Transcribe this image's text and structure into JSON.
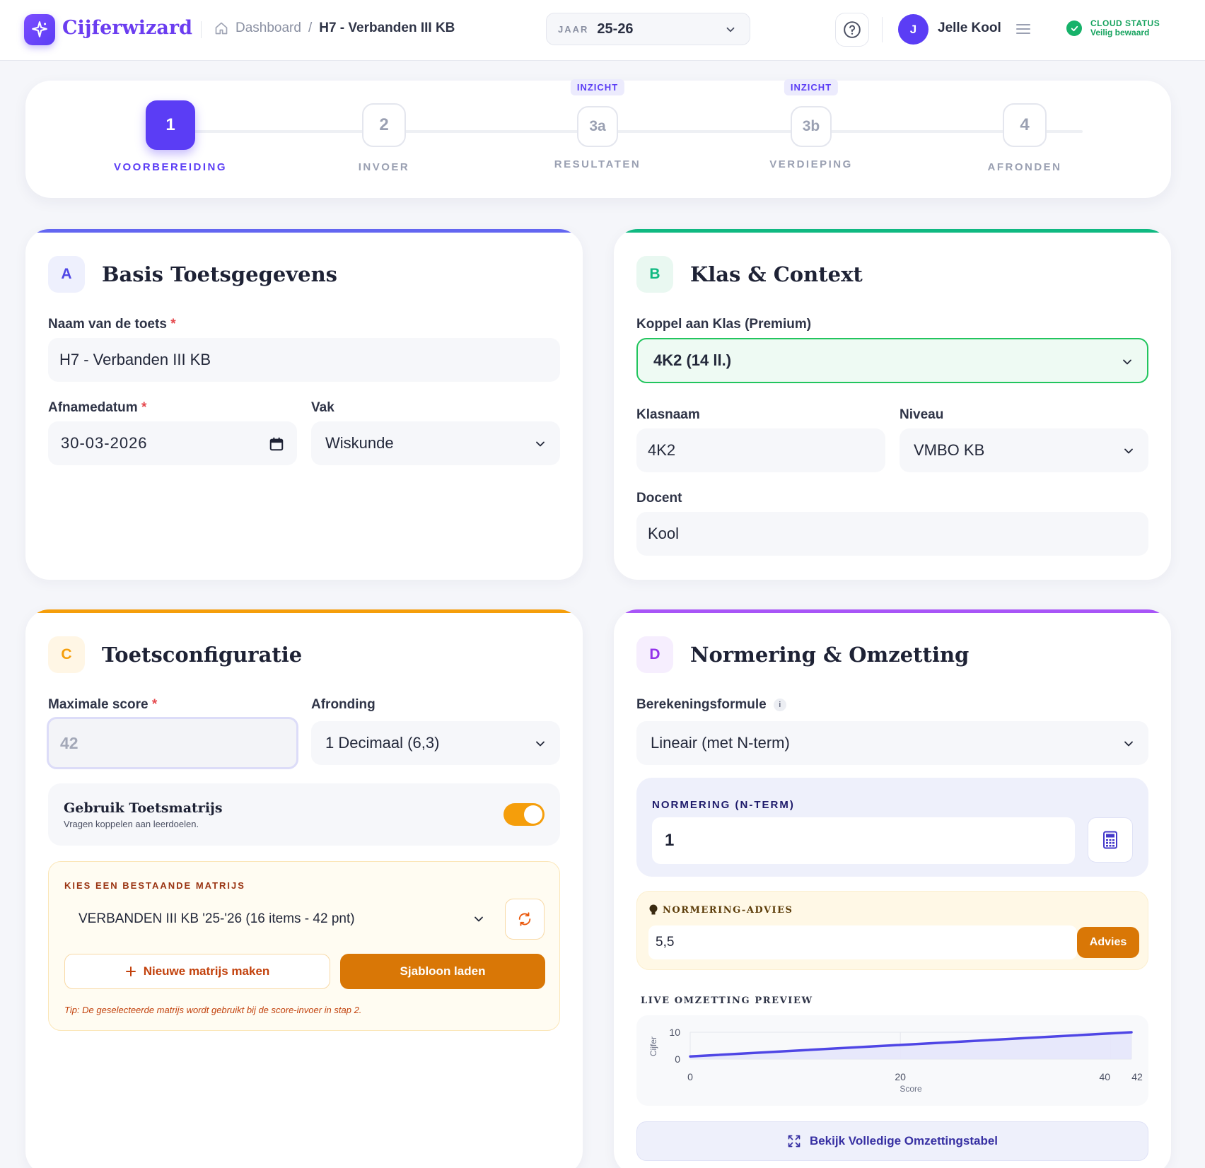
{
  "header": {
    "app_name": "Cijferwizard",
    "breadcrumb": {
      "home": "Dashboard",
      "separator": "/",
      "current": "H7 - Verbanden III KB"
    },
    "year": {
      "label": "JAAR",
      "value": "25-26"
    },
    "user": {
      "initial": "J",
      "name": "Jelle Kool"
    },
    "cloud": {
      "title": "CLOUD STATUS",
      "status": "Veilig bewaard"
    }
  },
  "stepper": {
    "steps": [
      {
        "number": "1",
        "label": "VOORBEREIDING",
        "badge": "",
        "active": true
      },
      {
        "number": "2",
        "label": "INVOER",
        "badge": ""
      },
      {
        "number": "3a",
        "label": "RESULTATEN",
        "badge": "INZICHT"
      },
      {
        "number": "3b",
        "label": "VERDIEPING",
        "badge": "INZICHT"
      },
      {
        "number": "4",
        "label": "AFRONDEN",
        "badge": ""
      }
    ]
  },
  "card_a": {
    "tag": "A",
    "title": "Basis Toetsgegevens",
    "name_label": "Naam van de toets",
    "name_value": "H7 - Verbanden III KB",
    "date_label": "Afnamedatum",
    "date_value": "30-03-2026",
    "subject_label": "Vak",
    "subject_value": "Wiskunde",
    "required_mark": "*"
  },
  "card_b": {
    "tag": "B",
    "title": "Klas & Context",
    "class_link_label": "Koppel aan Klas (Premium)",
    "class_link_value": "4K2 (14 ll.)",
    "classname_label": "Klasnaam",
    "classname_value": "4K2",
    "level_label": "Niveau",
    "level_value": "VMBO KB",
    "teacher_label": "Docent",
    "teacher_value": "Kool"
  },
  "card_c": {
    "tag": "C",
    "title": "Toetsconfiguratie",
    "max_label": "Maximale score",
    "max_value": "42",
    "rounding_label": "Afronding",
    "rounding_value": "1 Decimaal (6,3)",
    "matrix_toggle_title": "Gebruik Toetsmatrijs",
    "matrix_toggle_sub": "Vragen koppelen aan leerdoelen.",
    "matrix_toggle_on": true,
    "choose_label": "KIES EEN BESTAANDE MATRIJS",
    "matrix_value": "VERBANDEN III KB '25-'26 (16 items - 42 pnt)",
    "new_matrix": "Nieuwe matrijs maken",
    "load_template": "Sjabloon laden",
    "tip": "Tip: De geselecteerde matrijs wordt gebruikt bij de score-invoer in stap 2."
  },
  "card_d": {
    "tag": "D",
    "title": "Normering & Omzetting",
    "formula_label": "Berekeningsformule",
    "formula_info": "i",
    "formula_value": "Lineair (met N-term)",
    "nterm_label": "NORMERING (N-TERM)",
    "nterm_value": "1",
    "advice_label": "NORMERING-ADVIES",
    "advice_value": "5,5",
    "advice_button": "Advies",
    "preview_label": "LIVE OMZETTING PREVIEW",
    "full_table_button": "Bekijk Volledige Omzettingstabel"
  },
  "chart_data": {
    "type": "area",
    "xlabel": "Score",
    "ylabel": "Cijfer",
    "xlim": [
      0,
      42
    ],
    "ylim": [
      0,
      10
    ],
    "x_ticks": [
      "0",
      "20",
      "40",
      "42"
    ],
    "y_ticks": [
      "10",
      "0"
    ],
    "series": [
      {
        "x": [
          0,
          42
        ],
        "y": [
          1,
          10
        ]
      }
    ],
    "colors": {
      "line": "#4f46e5",
      "fill": "#e4e6fb"
    }
  },
  "colors": {
    "brand": "#5b3df5",
    "accent_a": "#6366f1",
    "accent_b": "#10b981",
    "accent_c": "#f59e0b",
    "accent_d": "#a855f7"
  }
}
